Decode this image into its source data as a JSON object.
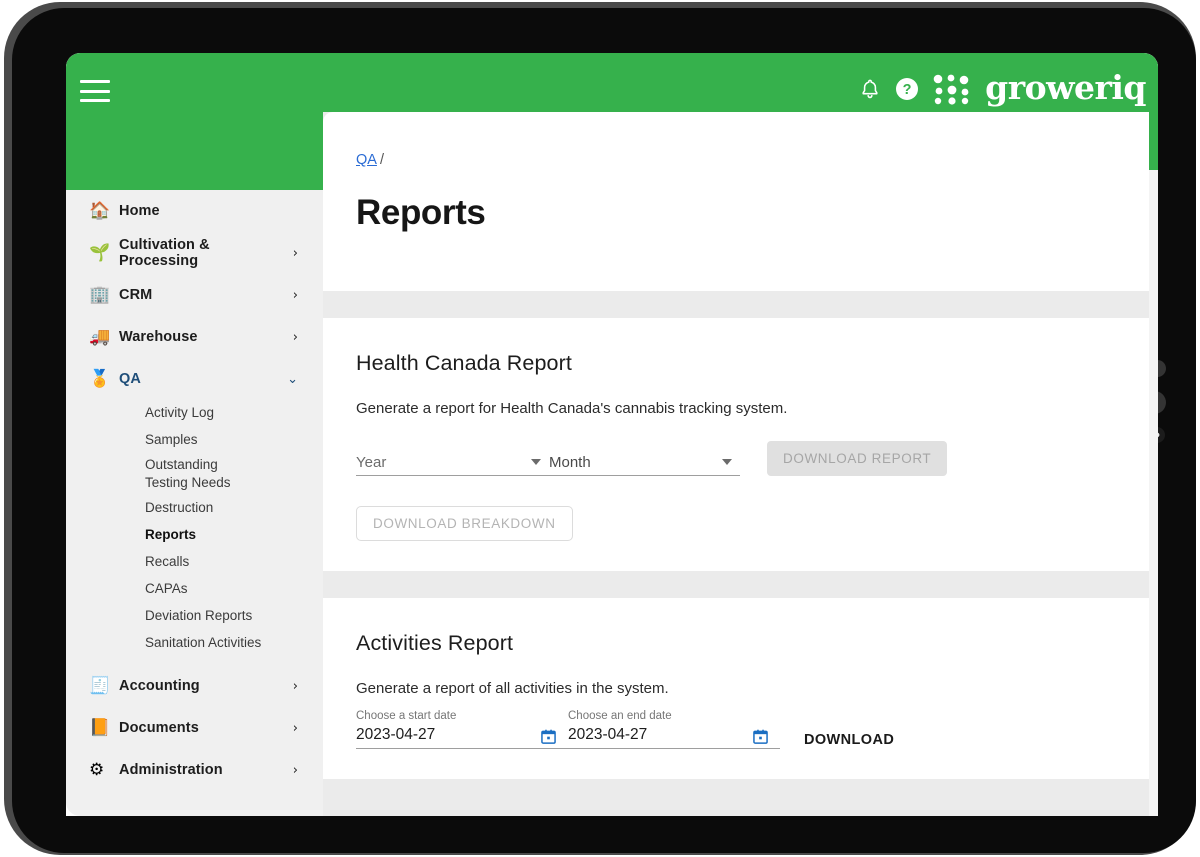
{
  "brand": {
    "name": "groweriq",
    "green": "#36b14c"
  },
  "topbar": {
    "menu_icon": "hamburger-menu-icon",
    "bell_icon": "notification-bell-icon",
    "help_icon": "help-circle-icon",
    "logo_icon": "groweriq-dots-logo-icon"
  },
  "sidebar": {
    "items": [
      {
        "label": "Home",
        "icon": "🏠",
        "icon_name": "house-icon",
        "expandable": false
      },
      {
        "label": "Cultivation & Processing",
        "icon": "🌱",
        "icon_name": "seedling-icon",
        "expandable": true,
        "chevron": "›"
      },
      {
        "label": "CRM",
        "icon": "🏢",
        "icon_name": "office-building-icon",
        "expandable": true,
        "chevron": "›"
      },
      {
        "label": "Warehouse",
        "icon": "🚚",
        "icon_name": "hand-truck-icon",
        "expandable": true,
        "chevron": "›"
      },
      {
        "label": "QA",
        "icon": "🏅",
        "icon_name": "rosette-award-icon",
        "expandable": true,
        "chevron": "⌄",
        "active": true
      }
    ],
    "qa_subitems": [
      {
        "label": "Activity Log"
      },
      {
        "label": "Samples"
      },
      {
        "label": "Outstanding Testing Needs"
      },
      {
        "label": "Destruction"
      },
      {
        "label": "Reports",
        "selected": true
      },
      {
        "label": "Recalls"
      },
      {
        "label": "CAPAs"
      },
      {
        "label": "Deviation Reports"
      },
      {
        "label": "Sanitation Activities"
      }
    ],
    "bottom_items": [
      {
        "label": "Accounting",
        "icon": "🧾",
        "icon_name": "receipt-calculator-icon",
        "chevron": "›"
      },
      {
        "label": "Documents",
        "icon": "📙",
        "icon_name": "document-icon",
        "chevron": "›"
      },
      {
        "label": "Administration",
        "icon": "⚙",
        "icon_name": "gear-settings-icon",
        "chevron": "›"
      }
    ]
  },
  "breadcrumb": {
    "parent": "QA",
    "separator": "/"
  },
  "page": {
    "title": "Reports"
  },
  "health_canada": {
    "title": "Health Canada Report",
    "description": "Generate a report for Health Canada's cannabis tracking system.",
    "year_placeholder": "Year",
    "month_placeholder": "Month",
    "download_report_label": "DOWNLOAD REPORT",
    "download_breakdown_label": "DOWNLOAD BREAKDOWN"
  },
  "activities": {
    "title": "Activities Report",
    "description": "Generate a report of all activities in the system.",
    "start_label": "Choose a start date",
    "start_value": "2023-04-27",
    "end_label": "Choose an end date",
    "end_value": "2023-04-27",
    "download_label": "DOWNLOAD"
  },
  "device": {
    "power_glyph": "◑"
  }
}
